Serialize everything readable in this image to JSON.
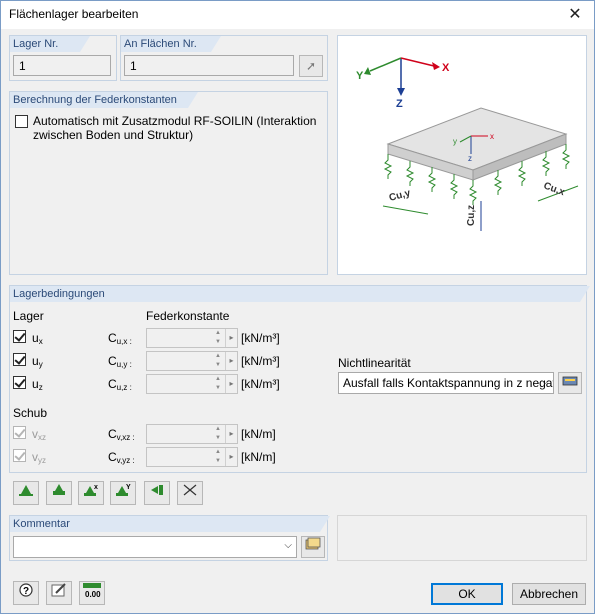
{
  "window": {
    "title": "Flächenlager bearbeiten",
    "close_glyph": "✕"
  },
  "lager_nr": {
    "label": "Lager Nr.",
    "value": "1"
  },
  "an_flaechen": {
    "label": "An Flächen Nr.",
    "value": "1"
  },
  "federkonstanten": {
    "label": "Berechnung der Federkonstanten",
    "checkbox_text_line1": "Automatisch mit Zusatzmodul RF-SOILIN (Interaktion",
    "checkbox_text_line2": "zwischen Boden und Struktur)",
    "checked": false
  },
  "diagram": {
    "axis_y": "Y",
    "axis_x": "X",
    "axis_z": "Z",
    "small_y": "y",
    "small_x": "x",
    "small_z": "z",
    "cuy_label": "Cu,y",
    "cux_label": "Cu,x",
    "cuz_label": "Cu,z"
  },
  "lagerbedingungen": {
    "label": "Lagerbedingungen",
    "col_lager": "Lager",
    "col_feder": "Federkonstante",
    "rows": [
      {
        "name": "u",
        "sub": "x",
        "cname": "C",
        "csub": "u,x :",
        "unit": "[kN/m³]",
        "checked": true
      },
      {
        "name": "u",
        "sub": "y",
        "cname": "C",
        "csub": "u,y :",
        "unit": "[kN/m³]",
        "checked": true
      },
      {
        "name": "u",
        "sub": "z",
        "cname": "C",
        "csub": "u,z :",
        "unit": "[kN/m³]",
        "checked": true
      }
    ],
    "schub_label": "Schub",
    "schub_rows": [
      {
        "name": "v",
        "sub": "xz",
        "cname": "C",
        "csub": "v,xz :",
        "unit": "[kN/m]",
        "checked": true
      },
      {
        "name": "v",
        "sub": "yz",
        "cname": "C",
        "csub": "v,yz :",
        "unit": "[kN/m]",
        "checked": true
      }
    ],
    "nichtlinearitaet_label": "Nichtlinearität",
    "nichtlinearitaet_value": "Ausfall falls Kontaktspannung in z negati"
  },
  "kommentar": {
    "label": "Kommentar",
    "value": ""
  },
  "buttons": {
    "ok": "OK",
    "cancel": "Abbrechen",
    "units_icon_text": "0.00"
  },
  "colors": {
    "accent": "#0078d7",
    "group_head": "#dde7f3",
    "axis_red": "#d0021b",
    "axis_green": "#2e8b2e",
    "axis_blue": "#1c3f94"
  }
}
